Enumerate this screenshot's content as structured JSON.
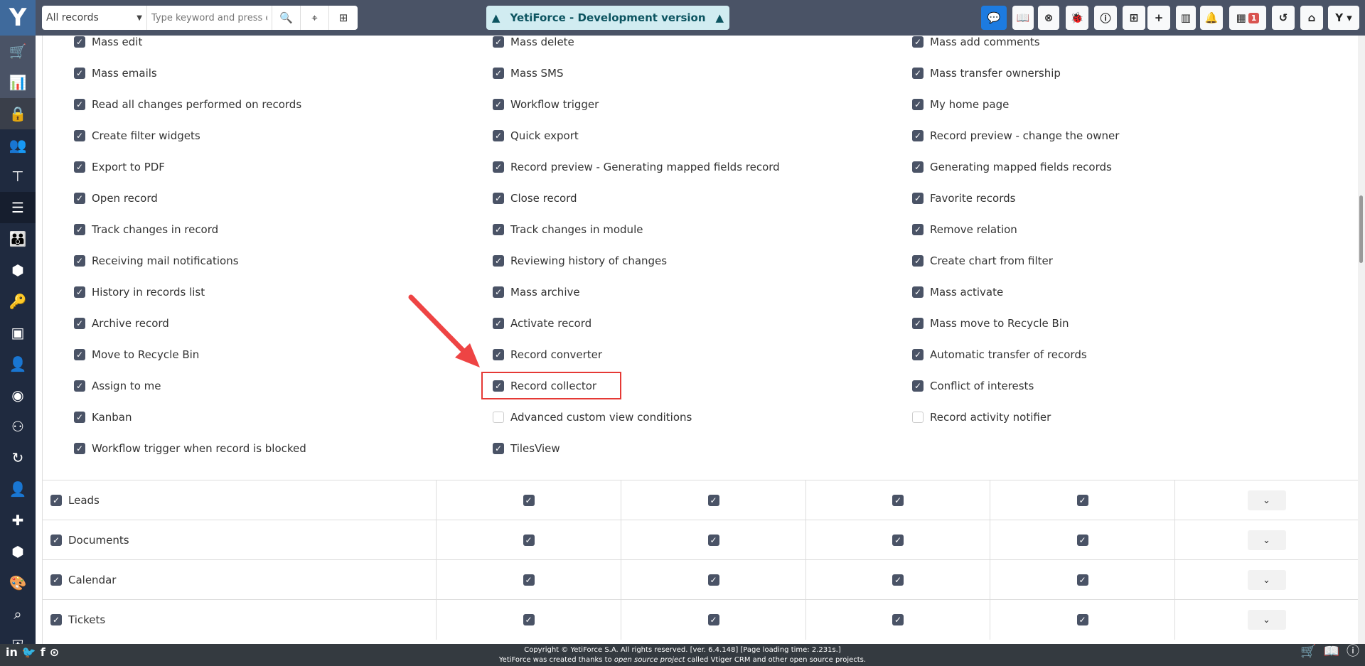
{
  "header": {
    "records_select": "All records",
    "search_placeholder": "Type keyword and press e",
    "dev_banner": "YetiForce - Development version",
    "notification_count": "1"
  },
  "permissions": {
    "col1": [
      "Mass edit",
      "Mass emails",
      "Read all changes performed on records",
      "Create filter widgets",
      "Export to PDF",
      "Open record",
      "Track changes in record",
      "Receiving mail notifications",
      "History in records list",
      "Archive record",
      "Move to Recycle Bin",
      "Assign to me",
      "Kanban",
      "Workflow trigger when record is blocked"
    ],
    "col2": [
      "Mass delete",
      "Mass SMS",
      "Workflow trigger",
      "Quick export",
      "Record preview - Generating mapped fields record",
      "Close record",
      "Track changes in module",
      "Reviewing history of changes",
      "Mass archive",
      "Activate record",
      "Record converter",
      "Record collector",
      "Advanced custom view conditions",
      "TilesView"
    ],
    "col3": [
      "Mass add comments",
      "Mass transfer ownership",
      "My home page",
      "Record preview - change the owner",
      "Generating mapped fields records",
      "Favorite records",
      "Remove relation",
      "Create chart from filter",
      "Mass activate",
      "Mass move to Recycle Bin",
      "Automatic transfer of records",
      "Conflict of interests",
      "Record activity notifier"
    ],
    "unchecked": [
      "Advanced custom view conditions",
      "Record activity notifier"
    ],
    "highlighted": "Record collector"
  },
  "modules": [
    {
      "name": "Leads"
    },
    {
      "name": "Documents"
    },
    {
      "name": "Calendar"
    },
    {
      "name": "Tickets"
    }
  ],
  "footer": {
    "line1": "Copyright © YetiForce S.A. All rights reserved. [ver. 6.4.148] [Page loading time: 2.231s.]",
    "line2_pre": "YetiForce was created thanks to ",
    "line2_link": "open source project",
    "line2_post": " called Vtiger CRM and other open source projects."
  },
  "colors": {
    "accent": "#4a5366",
    "highlight": "#e53935",
    "banner": "#d1ecf1"
  }
}
